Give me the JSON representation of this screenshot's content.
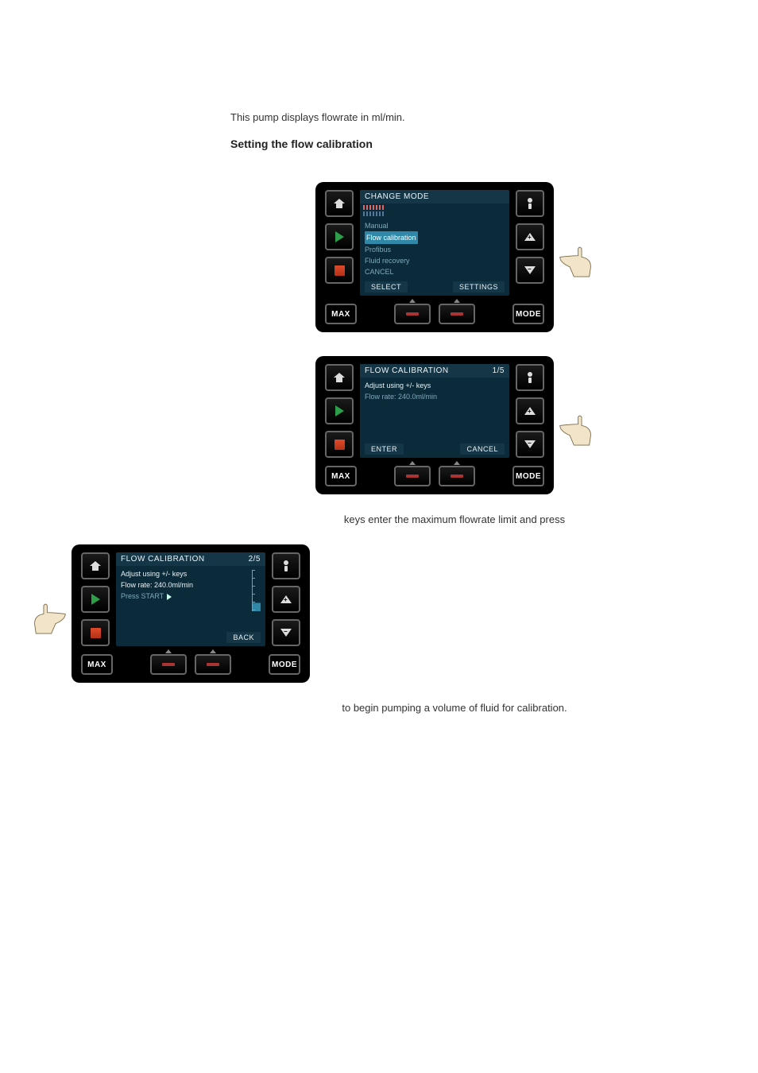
{
  "intro": "This pump displays flowrate in ml/min.",
  "section_title": "Setting the flow calibration",
  "captions": {
    "keys_enter": "keys enter the maximum flowrate limit and press",
    "begin_pump": "to begin pumping a volume of fluid for calibration."
  },
  "common": {
    "max_label": "MAX",
    "mode_label": "MODE"
  },
  "screen1": {
    "title": "CHANGE MODE",
    "items": [
      "Manual",
      "Flow calibration",
      "Profibus",
      "Fluid recovery",
      "CANCEL"
    ],
    "highlight_index": 1,
    "footer": {
      "left": "SELECT",
      "right": "SETTINGS"
    }
  },
  "screen2": {
    "title": "FLOW CALIBRATION",
    "page": "1/5",
    "line1": "Adjust using +/- keys",
    "line2": "Flow rate: 240.0ml/min",
    "footer": {
      "left": "ENTER",
      "right": "CANCEL"
    }
  },
  "screen3": {
    "title": "FLOW CALIBRATION",
    "page": "2/5",
    "line1": "Adjust using +/- keys",
    "line2": "Flow rate: 240.0ml/min",
    "line3": "Press START",
    "footer": {
      "left": "",
      "right": "BACK"
    }
  }
}
